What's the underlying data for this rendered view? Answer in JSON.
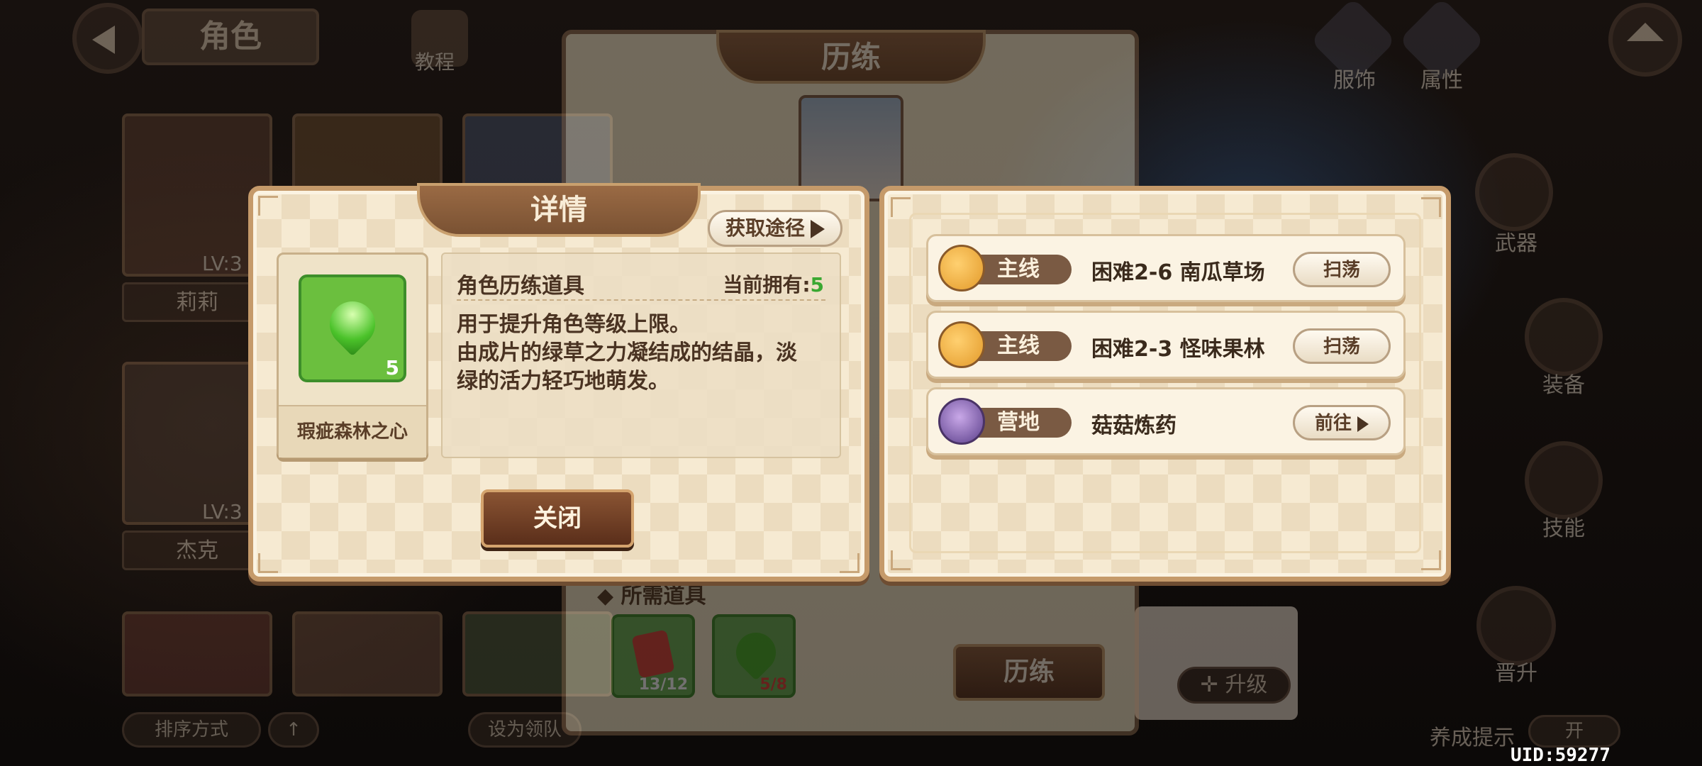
{
  "background": {
    "top_title": "角色",
    "tutorial_label": "教程",
    "right_top": [
      "服饰",
      "属性"
    ],
    "side_menu": [
      "武器",
      "装备",
      "技能",
      "晋升"
    ],
    "characters": [
      {
        "name": "莉莉",
        "level": "LV:3"
      },
      {
        "name": "杰克",
        "level": "LV:3"
      }
    ],
    "sort_label": "排序方式",
    "team_label": "设为领队",
    "upgrade_label": "升级",
    "hint_label": "养成提示",
    "hint_toggle": "开",
    "uid": "UID:59277",
    "back_panel": {
      "title": "历练",
      "required_label": "所需道具",
      "items": [
        {
          "count": "13/12",
          "color": "#d9463a"
        },
        {
          "count": "5/8",
          "color": "#49b02a"
        }
      ],
      "train_button": "历练"
    }
  },
  "detail": {
    "title": "详情",
    "acquire_button": "获取途径",
    "item_name": "瑕疵森林之心",
    "item_count": "5",
    "category": "角色历练道具",
    "owned_label": "当前拥有:",
    "owned_value": "5",
    "desc_line1": "用于提升角色等级上限。",
    "desc_line2": "由成片的绿草之力凝结成的结晶，淡",
    "desc_line3": "绿的活力轻巧地萌发。",
    "close_button": "关闭"
  },
  "sources": [
    {
      "tag": "主线",
      "text": "困难2-6 南瓜草场",
      "button": "扫荡",
      "icon": "cat-face-icon"
    },
    {
      "tag": "主线",
      "text": "困难2-3 怪味果林",
      "button": "扫荡",
      "icon": "cat-face-icon"
    },
    {
      "tag": "营地",
      "text": "菇菇炼药",
      "button": "前往",
      "icon": "camp-character-icon"
    }
  ],
  "colors": {
    "accent_green": "#3aa832",
    "panel_border": "#c59a6a",
    "banner_brown": "#7a5233"
  }
}
